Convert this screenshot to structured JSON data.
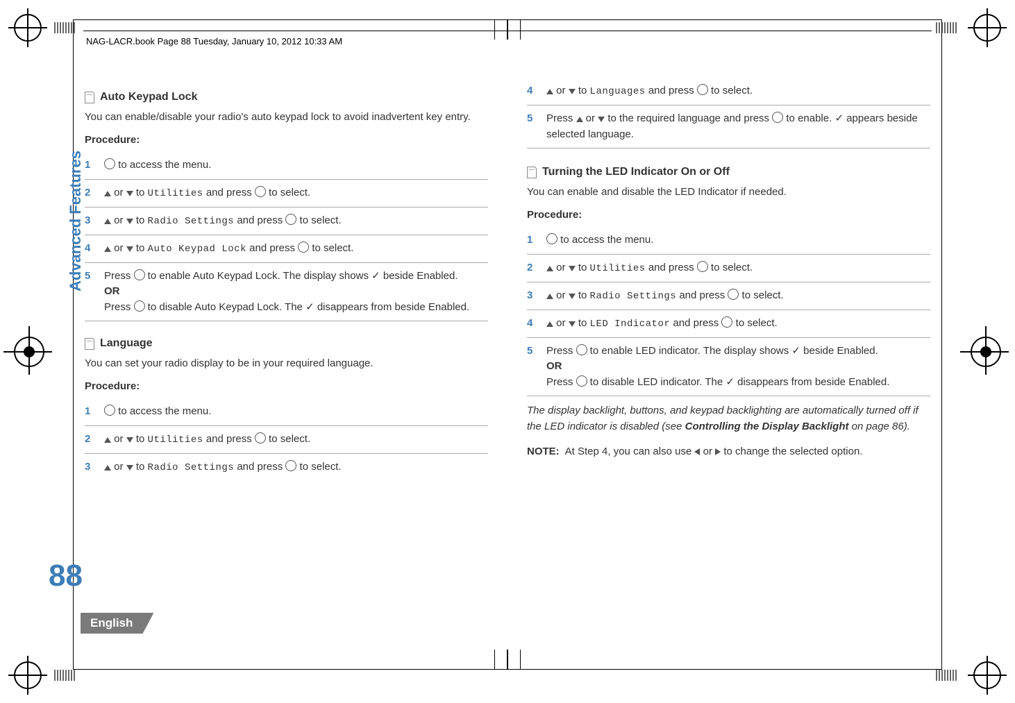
{
  "header_footer_text": "NAG-LACR.book  Page 88  Tuesday, January 10, 2012  10:33 AM",
  "sidebar_label": "Advanced Features",
  "page_number": "88",
  "language_tab": "English",
  "left": {
    "sec1_title": "Auto Keypad Lock",
    "sec1_desc": "You can enable/disable your radio's auto keypad lock to avoid inadvertent key entry.",
    "sec2_title": "Language",
    "sec2_desc": "You can set your radio display to be in your required language.",
    "proc_label": "Procedure:",
    "s1_p1_a": " to access the menu.",
    "s1_p2_a": " or ",
    "s1_p2_b": " to ",
    "s1_p2_menu": "Utilities",
    "s1_p2_c": " and press ",
    "s1_p2_d": " to select.",
    "s1_p3_menu": "Radio Settings",
    "s1_p4_menu": "Auto Keypad Lock",
    "s1_p5_a": "Press ",
    "s1_p5_b": " to enable Auto Keypad Lock. The display shows ",
    "s1_p5_c": " beside Enabled.",
    "s1_p5_or": "OR",
    "s1_p5_d": "Press ",
    "s1_p5_e": " to disable Auto Keypad Lock. The ",
    "s1_p5_f": " disappears from beside Enabled."
  },
  "right": {
    "top4_a": " or ",
    "top4_b": " to ",
    "top4_menu": "Languages",
    "top4_c": " and press ",
    "top4_d": " to select.",
    "top5_a": "Press ",
    "top5_b": " or ",
    "top5_c": " to the required language and press ",
    "top5_d": " to enable. ",
    "top5_e": " appears beside selected language.",
    "sec_title": "Turning the LED Indicator On or Off",
    "sec_desc": "You can enable and disable the LED Indicator if needed.",
    "proc_label": "Procedure:",
    "p1_a": " to access the menu.",
    "p2_menu": "Utilities",
    "p3_menu": "Radio Settings",
    "p4_menu": "LED Indicator",
    "common_or_to": " or ",
    "common_to": " to ",
    "common_press": " and press ",
    "common_select": " to select.",
    "p5_a": "Press ",
    "p5_b": " to enable LED indicator. The display shows ",
    "p5_c": " beside Enabled.",
    "p5_or": "OR",
    "p5_d": "Press ",
    "p5_e": " to disable LED indicator. The ",
    "p5_f": " disappears from beside Enabled.",
    "ital_a": "The display backlight, buttons, and keypad backlighting are automatically turned off if the LED indicator is disabled (see ",
    "ital_b": "Controlling the Display Backlight",
    "ital_c": " on page 86).",
    "note_label": "NOTE:",
    "note_a": "At Step 4, you can also use ",
    "note_b": " or ",
    "note_c": " to change the selected option."
  },
  "nums": {
    "n1": "1",
    "n2": "2",
    "n3": "3",
    "n4": "4",
    "n5": "5"
  },
  "check": "✓"
}
